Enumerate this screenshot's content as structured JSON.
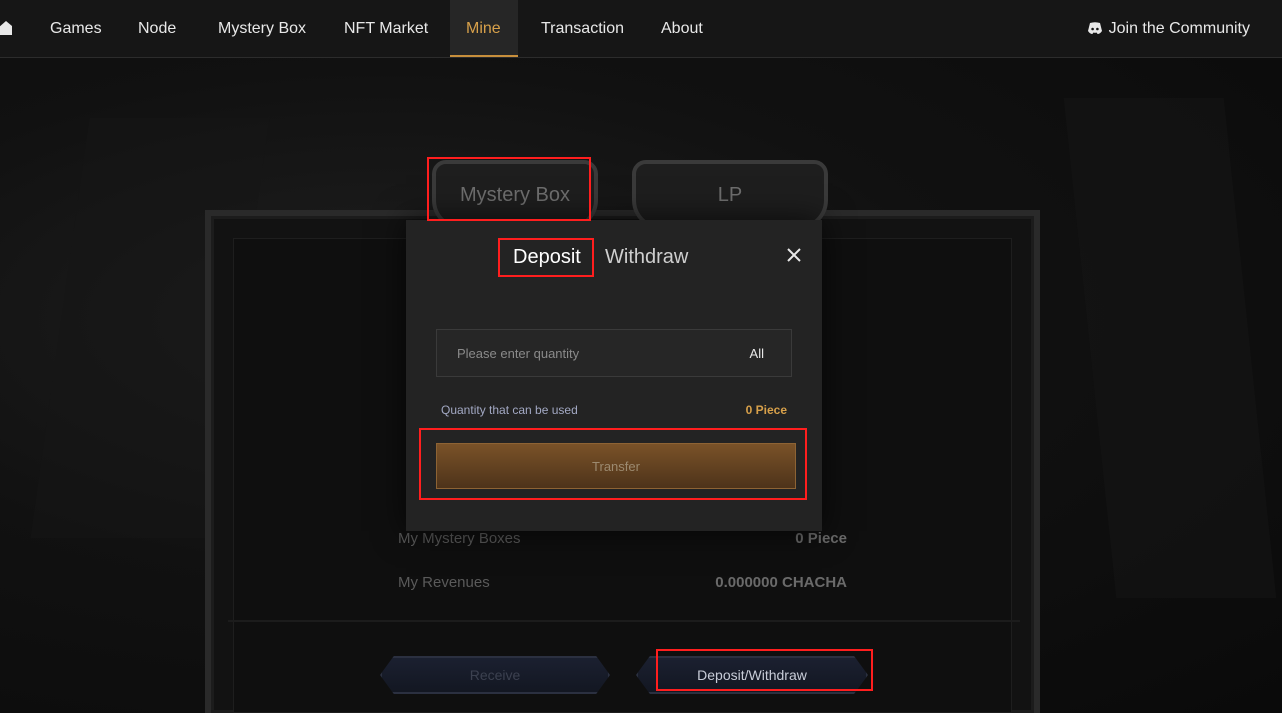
{
  "nav": {
    "home_icon": "home-icon",
    "items": [
      {
        "label": "Games"
      },
      {
        "label": "Node"
      },
      {
        "label": "Mystery Box"
      },
      {
        "label": "NFT Market"
      },
      {
        "label": "Mine"
      },
      {
        "label": "Transaction"
      },
      {
        "label": "About"
      }
    ],
    "active": "Mine",
    "community_label": "Join the Community",
    "community_icon": "discord-icon"
  },
  "background": {
    "tabs": [
      {
        "label": "Mystery Box"
      },
      {
        "label": "LP"
      }
    ],
    "stats": [
      {
        "label": "My Mystery Boxes",
        "value": "0 Piece"
      },
      {
        "label": "My Revenues",
        "value": "0.000000 CHACHA"
      }
    ],
    "receive_label": "Receive",
    "deposit_withdraw_label": "Deposit/Withdraw"
  },
  "modal": {
    "tabs": [
      {
        "label": "Deposit"
      },
      {
        "label": "Withdraw"
      }
    ],
    "active_tab": "Deposit",
    "quantity_placeholder": "Please enter quantity",
    "quantity_value": "",
    "all_label": "All",
    "usable_label": "Quantity that can be used",
    "usable_value": "0 Piece",
    "transfer_label": "Transfer"
  },
  "colors": {
    "accent": "#d7a04a",
    "annotation": "#ff1e1e",
    "modal_bg": "#232323"
  }
}
